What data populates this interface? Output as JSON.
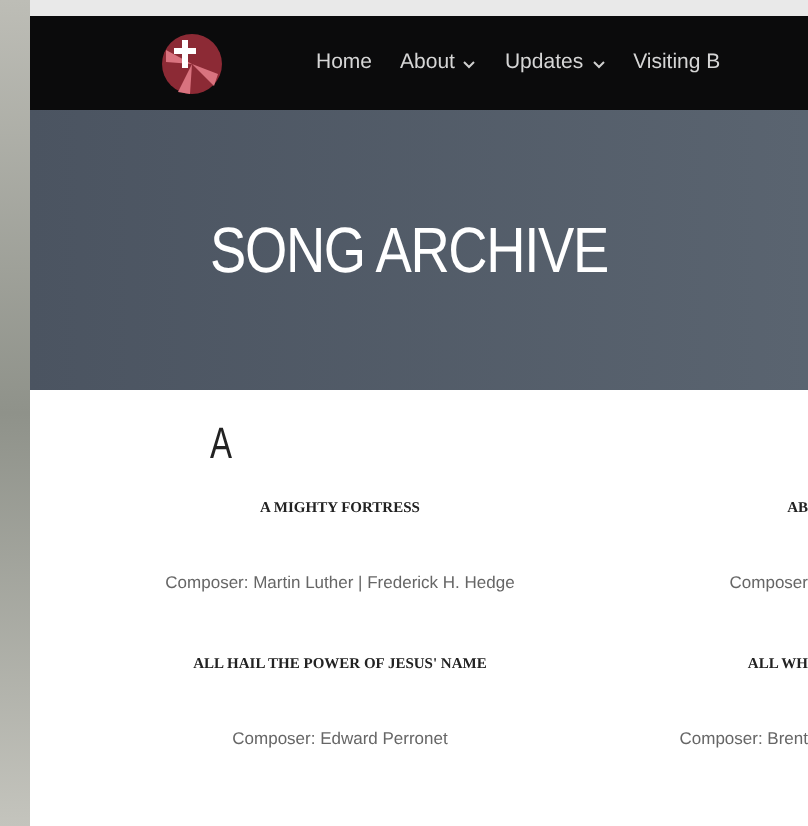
{
  "nav": {
    "items": [
      {
        "label": "Home",
        "dropdown": false
      },
      {
        "label": "About",
        "dropdown": true
      },
      {
        "label": "Updates",
        "dropdown": true
      },
      {
        "label": "Visiting B",
        "dropdown": false
      }
    ]
  },
  "hero": {
    "title": "SONG ARCHIVE"
  },
  "section": {
    "letter": "A",
    "songs": [
      {
        "title": "A MIGHTY FORTRESS",
        "composer": "Composer: Martin Luther | Frederick H. Hedge"
      },
      {
        "title": "AB",
        "composer": "Composer"
      },
      {
        "title": "ALL HAIL THE POWER OF JESUS' NAME",
        "composer": "Composer: Edward Perronet"
      },
      {
        "title": "ALL WH",
        "composer": "Composer: Brent"
      }
    ]
  }
}
